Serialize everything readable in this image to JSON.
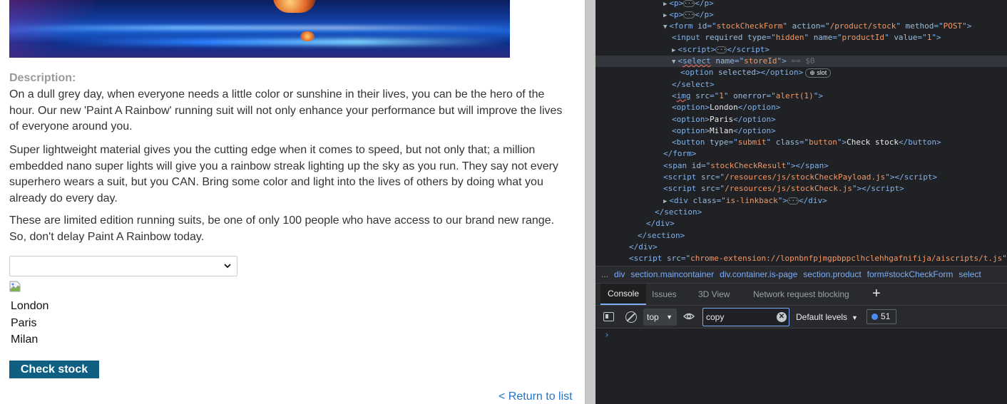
{
  "product": {
    "description_label": "Description:",
    "paragraphs": [
      "On a dull grey day, when everyone needs a little color or sunshine in their lives, you can be the hero of the hour. Our new 'Paint A Rainbow' running suit will not only enhance your performance but will improve the lives of everyone around you.",
      "Super lightweight material gives you the cutting edge when it comes to speed, but not only that; a million embedded nano super lights will give you a rainbow streak lighting up the sky as you run. They say not every superhero wears a suit, but you CAN. Bring some color and light into the lives of others by doing what you already do every day.",
      "These are limited edition running suits, be one of only 100 people who have access to our brand new range. So, don't delay Paint A Rainbow today."
    ],
    "store_select": {
      "selected": ""
    },
    "options": [
      "London",
      "Paris",
      "Milan"
    ],
    "check_button": "Check stock",
    "return_link": "< Return to list"
  },
  "devtools": {
    "dom_lines": [
      {
        "indent": 7,
        "html": "<span class='tri'>▶</span><span class='tag'>&lt;p&gt;</span><span class='dots'>···</span><span class='tag'>&lt;/p&gt;</span>"
      },
      {
        "indent": 7,
        "html": "<span class='tri'>▶</span><span class='tag'>&lt;p&gt;</span><span class='dots'>···</span><span class='tag'>&lt;/p&gt;</span>"
      },
      {
        "indent": 7,
        "html": "<span class='tri'>▼</span><span class='tag'>&lt;form </span><span class='an'>id</span><span class='tag'>=\"</span><span class='av'>stockCheckForm</span><span class='tag'>\" </span><span class='an'>action</span><span class='tag'>=\"</span><span class='av'>/product/stock</span><span class='tag'>\" </span><span class='an'>method</span><span class='tag'>=\"</span><span class='av'>POST</span><span class='tag'>\"&gt;</span>"
      },
      {
        "indent": 8,
        "html": "<span class='tag'>&lt;input </span><span class='an'>required type</span><span class='tag'>=\"</span><span class='av'>hidden</span><span class='tag'>\" </span><span class='an'>name</span><span class='tag'>=\"</span><span class='av'>productId</span><span class='tag'>\" </span><span class='an'>value</span><span class='tag'>=\"</span><span class='av'>1</span><span class='tag'>\"&gt;</span>"
      },
      {
        "indent": 8,
        "html": "<span class='tri'>▶</span><span class='tag'>&lt;script&gt;</span><span class='dots'>···</span><span class='tag'>&lt;/script&gt;</span>"
      },
      {
        "indent": 8,
        "html": "<span class='tri'>▼</span><span class='tag'>&lt;<span class='squig'>select</span> </span><span class='an'>name</span><span class='tag'>=\"</span><span class='av'>storeId</span><span class='tag'>\"&gt;</span> <span class='cm'>== $0</span>",
        "selected": true
      },
      {
        "indent": 9,
        "html": "<span class='tag'>&lt;option </span><span class='an'>selected</span><span class='tag'>&gt;&lt;/option&gt;</span><span class='slot'>⊕ slot</span>"
      },
      {
        "indent": 8,
        "html": "<span class='tag'>&lt;/select&gt;</span>"
      },
      {
        "indent": 8,
        "html": "<span class='tag'>&lt;<span class='squig'>img</span> </span><span class='an'>src</span><span class='tag'>=\"</span><span class='av'>1</span><span class='tag'>\" </span><span class='an'>onerror</span><span class='tag'>=\"</span><span class='av'>alert(1)</span><span class='tag'>\"&gt;</span>"
      },
      {
        "indent": 8,
        "html": "<span class='tag'>&lt;option&gt;</span><span class='tx'>London</span><span class='tag'>&lt;/option&gt;</span>"
      },
      {
        "indent": 8,
        "html": "<span class='tag'>&lt;option&gt;</span><span class='tx'>Paris</span><span class='tag'>&lt;/option&gt;</span>"
      },
      {
        "indent": 8,
        "html": "<span class='tag'>&lt;option&gt;</span><span class='tx'>Milan</span><span class='tag'>&lt;/option&gt;</span>"
      },
      {
        "indent": 8,
        "html": "<span class='tag'>&lt;button </span><span class='an'>type</span><span class='tag'>=\"</span><span class='av'>submit</span><span class='tag'>\" </span><span class='an'>class</span><span class='tag'>=\"</span><span class='av'>button</span><span class='tag'>\"&gt;</span><span class='tx'>Check stock</span><span class='tag'>&lt;/button&gt;</span>"
      },
      {
        "indent": 7,
        "html": "<span class='tag'>&lt;/form&gt;</span>"
      },
      {
        "indent": 7,
        "html": "<span class='tag'>&lt;span </span><span class='an'>id</span><span class='tag'>=\"</span><span class='av'>stockCheckResult</span><span class='tag'>\"&gt;&lt;/span&gt;</span>"
      },
      {
        "indent": 7,
        "html": "<span class='tag'>&lt;script </span><span class='an'>src</span><span class='tag'>=\"</span><span class='av'>/resources/js/stockCheckPayload.js</span><span class='tag'>\"&gt;&lt;/script&gt;</span>"
      },
      {
        "indent": 7,
        "html": "<span class='tag'>&lt;script </span><span class='an'>src</span><span class='tag'>=\"</span><span class='av'>/resources/js/stockCheck.js</span><span class='tag'>\"&gt;&lt;/script&gt;</span>"
      },
      {
        "indent": 7,
        "html": "<span class='tri'>▶</span><span class='tag'>&lt;div </span><span class='an'>class</span><span class='tag'>=\"</span><span class='av'>is-linkback</span><span class='tag'>\"&gt;</span><span class='dots'>···</span><span class='tag'>&lt;/div&gt;</span>"
      },
      {
        "indent": 6,
        "html": "<span class='tag'>&lt;/section&gt;</span>"
      },
      {
        "indent": 5,
        "html": "<span class='tag'>&lt;/div&gt;</span>"
      },
      {
        "indent": 4,
        "html": "<span class='tag'>&lt;/section&gt;</span>"
      },
      {
        "indent": 3,
        "html": "<span class='tag'>&lt;/div&gt;</span>"
      },
      {
        "indent": 3,
        "html": "<span class='tag'>&lt;script </span><span class='an'>src</span><span class='tag'>=\"</span><span class='av'>chrome-extension://lopnbnfpjmgpbppclhclehhgafnifija/aiscripts/t.js</span><span class='tag'>\"&gt;</span>"
      }
    ],
    "gutter": "···",
    "breadcrumbs": [
      "...",
      "div",
      "section.maincontainer",
      "div.container.is-page",
      "section.product",
      "form#stockCheckForm",
      "select"
    ],
    "tabs": {
      "console": "Console",
      "issues": "Issues",
      "three_d": "3D View",
      "network_blocking": "Network request blocking",
      "add": "+"
    },
    "context": "top",
    "filter_value": "copy",
    "levels": "Default levels",
    "issues_count": "51",
    "prompt": "›"
  }
}
